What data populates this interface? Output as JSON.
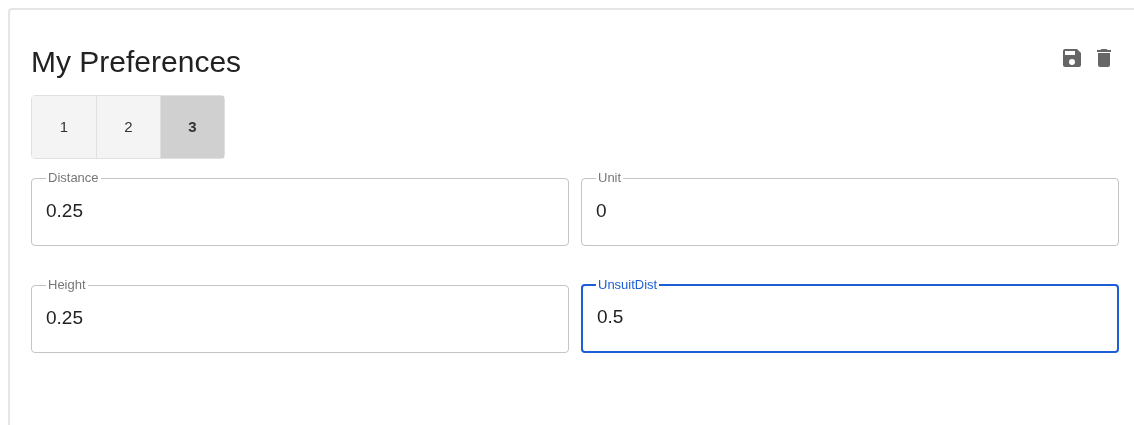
{
  "title": "My Preferences",
  "actions": [
    {
      "kind": "save"
    },
    {
      "kind": "delete"
    }
  ],
  "tabs": [
    {
      "label": "1",
      "selected": false
    },
    {
      "label": "2",
      "selected": false
    },
    {
      "label": "3",
      "selected": true
    }
  ],
  "fields": [
    {
      "label": "Distance",
      "value": "0.25",
      "focused": false
    },
    {
      "label": "Unit",
      "value": "0",
      "focused": false
    },
    {
      "label": "Height",
      "value": "0.25",
      "focused": false
    },
    {
      "label": "UnsuitDist",
      "value": "0.5",
      "focused": true
    }
  ]
}
